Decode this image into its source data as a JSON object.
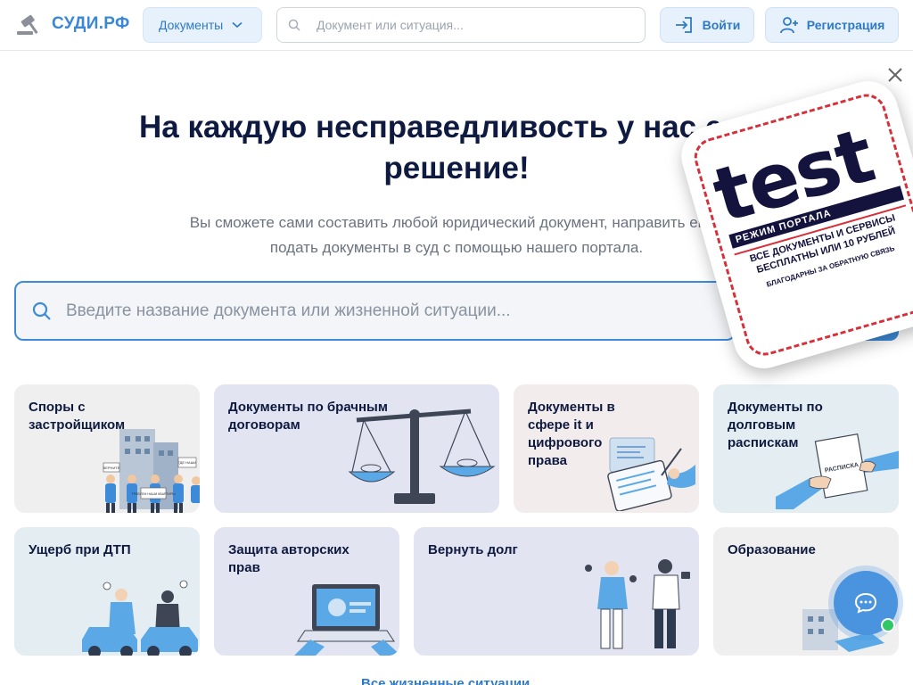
{
  "header": {
    "logo_text": "СУДИ.РФ",
    "docs_label": "Документы",
    "search_placeholder": "Документ или ситуация...",
    "login_label": "Войти",
    "register_label": "Регистрация"
  },
  "hero": {
    "title_line1": "На каждую несправедливость у нас есть",
    "title_line2": "решение!",
    "subtitle_line1": "Вы сможете сами составить любой юридический документ, направить его с",
    "subtitle_line2": "подать документы в суд с помощью нашего портала.",
    "search_placeholder": "Введите название документа или жизненной ситуации..."
  },
  "cards": [
    {
      "title": "Споры с застройщиком"
    },
    {
      "title": "Документы по брачным договорам"
    },
    {
      "title": "Документы в сфере it и цифрового права"
    },
    {
      "title": "Документы по долговым распискам"
    },
    {
      "title": "Ущерб при ДТП"
    },
    {
      "title": "Защита авторских прав"
    },
    {
      "title": "Вернуть долг"
    },
    {
      "title": "Образование"
    }
  ],
  "illustration_labels": {
    "poster1": "ВЕРНИТЕ",
    "poster2": "ГДЕ НАШИ",
    "banner": "ТРЕБУЕМ НАШИ КВАРТИРЫ",
    "receipt": "РАСПИСКА"
  },
  "link_all": "Все жизненные ситуации",
  "stamp": {
    "word": "test",
    "mode": "РЕЖИМ ПОРТАЛА",
    "line1": "ВСЕ ДОКУМЕНТЫ И СЕРВИСЫ БЕСПЛАТНЫ ИЛИ 10 РУБЛЕЙ",
    "line2": "БЛАГОДАРНЫ ЗА ОБРАТНУЮ СВЯЗЬ"
  },
  "colors": {
    "accent": "#3d8bd8",
    "title": "#0e1a3f",
    "stamp_red": "#d6303a"
  }
}
